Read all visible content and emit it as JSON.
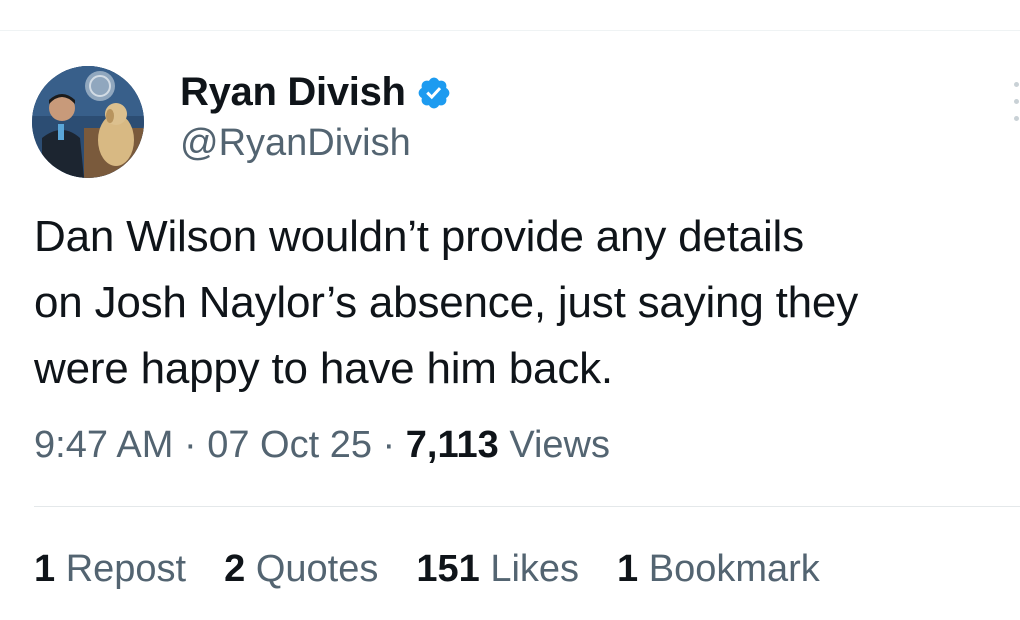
{
  "author": {
    "display_name": "Ryan Divish",
    "handle": "@RyanDivish",
    "verified": true,
    "verified_color": "#1d9bf0"
  },
  "tweet": {
    "text": "Dan Wilson wouldn’t provide any details\non Josh Naylor’s absence, just saying they\nwere happy to have him back."
  },
  "meta": {
    "time": "9:47 AM",
    "separator": "·",
    "date": "07 Oct 25",
    "views_count": "7,113",
    "views_label": "Views"
  },
  "stats": {
    "reposts": {
      "count": "1",
      "label": "Repost"
    },
    "quotes": {
      "count": "2",
      "label": "Quotes"
    },
    "likes": {
      "count": "151",
      "label": "Likes"
    },
    "bookmarks": {
      "count": "1",
      "label": "Bookmark"
    }
  },
  "colors": {
    "text": "#0f1419",
    "secondary": "#536471",
    "divider": "#eff3f4"
  }
}
